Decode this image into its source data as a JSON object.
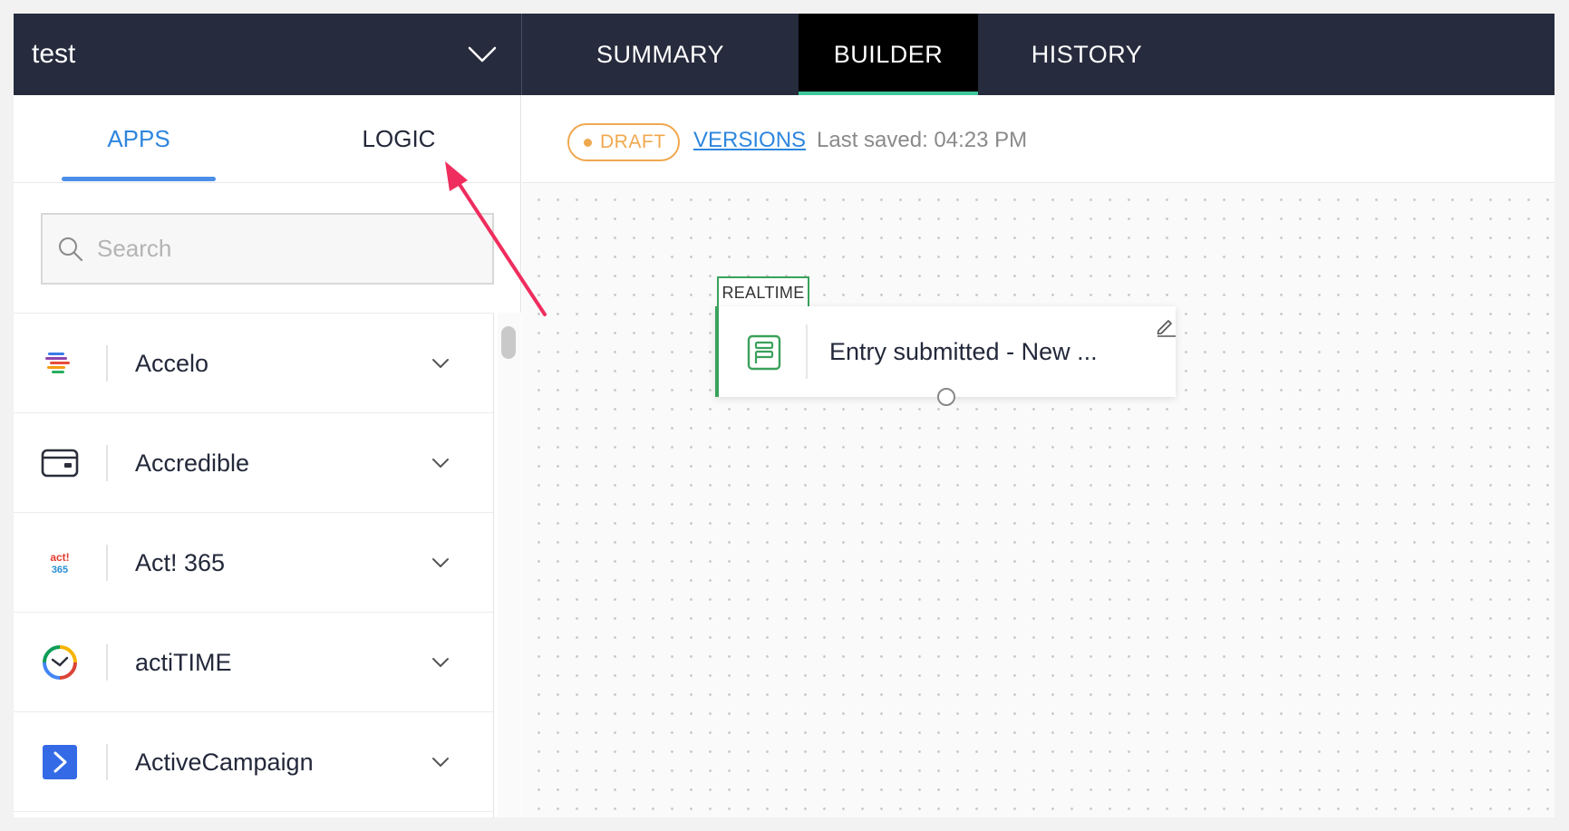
{
  "header": {
    "workflow_name": "test",
    "tabs": [
      {
        "label": "SUMMARY"
      },
      {
        "label": "BUILDER"
      },
      {
        "label": "HISTORY"
      }
    ]
  },
  "left_panel": {
    "tabs": [
      {
        "label": "APPS"
      },
      {
        "label": "LOGIC"
      }
    ],
    "search": {
      "placeholder": "Search",
      "value": ""
    },
    "apps": [
      {
        "name": "Accelo",
        "logo": "accelo-logo"
      },
      {
        "name": "Accredible",
        "logo": "accredible-logo"
      },
      {
        "name": "Act! 365",
        "logo": "act365-logo",
        "logo_text": [
          "act!",
          "365"
        ]
      },
      {
        "name": "actiTIME",
        "logo": "actitime-logo"
      },
      {
        "name": "ActiveCampaign",
        "logo": "activecampaign-logo"
      }
    ]
  },
  "status": {
    "badge": "DRAFT",
    "versions_link": "VERSIONS",
    "last_saved": "Last saved: 04:23 PM"
  },
  "canvas": {
    "trigger": {
      "type_label": "REALTIME",
      "title": "Entry submitted - New ...",
      "icon": "form-icon"
    }
  },
  "colors": {
    "header_bg": "#262b3d",
    "active_tab_bg": "#000000",
    "active_tab_underline": "#3fc79c",
    "accent_blue": "#2e86de",
    "draft_orange": "#f0a84e",
    "trigger_green": "#3aa15b",
    "annotation_arrow": "#ef2d5e"
  }
}
